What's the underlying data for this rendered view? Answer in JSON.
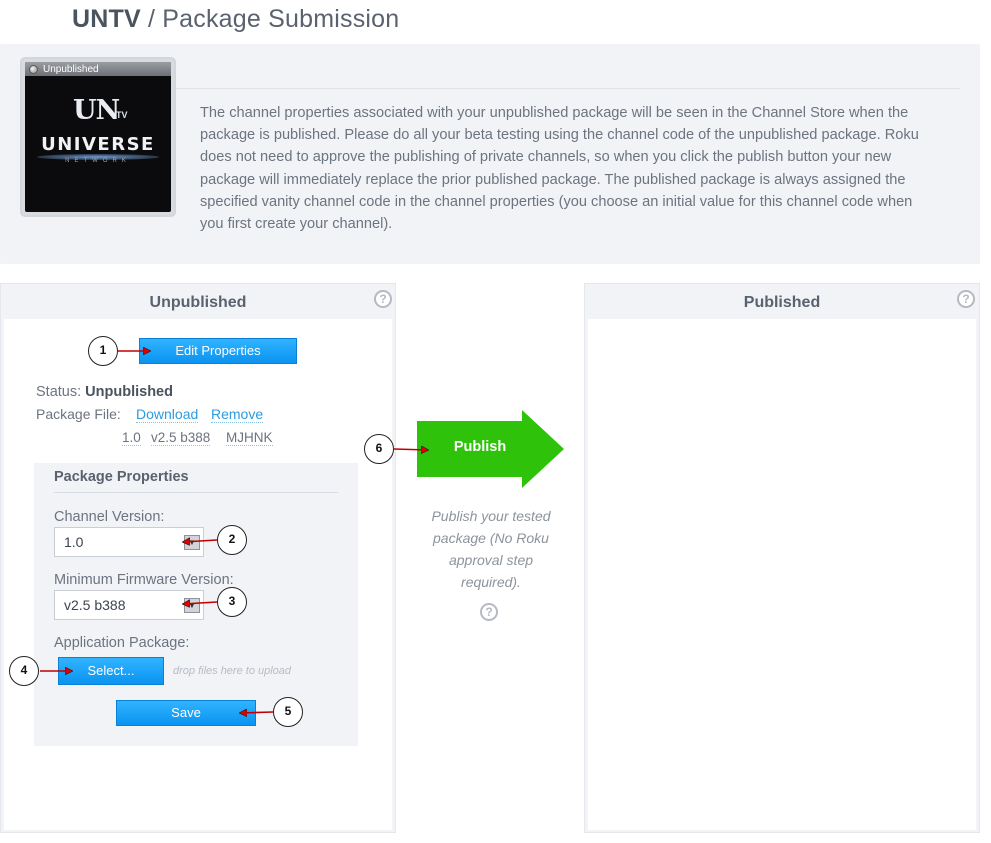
{
  "header": {
    "channel": "UNTV",
    "separator": " / ",
    "title": "Package Submission"
  },
  "info": {
    "thumbnail_badge": "Unpublished",
    "logo_top": "UN",
    "logo_tv": "TV",
    "logo_main": "UNIVERSE",
    "logo_sub": "NETWORK",
    "text": "The channel properties associated with your unpublished package will be seen in the Channel Store when the package is published. Please do all your beta testing using the channel code of the unpublished package. Roku does not need to approve the publishing of private channels, so when you click the publish button your new package will immediately replace the prior published package. The published package is always assigned the specified vanity channel code in the channel properties (you choose an initial value for this channel code when you first create your channel)."
  },
  "unpublished": {
    "heading": "Unpublished",
    "help": "?",
    "edit_button": "Edit Properties",
    "status_label": "Status: ",
    "status_value": "Unpublished",
    "package_file_label": "Package File: ",
    "download_link": "Download",
    "remove_link": "Remove",
    "version": "1.0",
    "build": "v2.5 b388",
    "code": "MJHNK"
  },
  "package_properties": {
    "title": "Package Properties",
    "channel_version_label": "Channel Version:",
    "channel_version_value": "1.0",
    "min_firmware_label": "Minimum Firmware Version:",
    "min_firmware_value": "v2.5 b388",
    "app_package_label": "Application Package:",
    "select_button": "Select...",
    "drop_hint": "drop files here to upload",
    "save_button": "Save"
  },
  "publish": {
    "button": "Publish",
    "note": "Publish your tested package (No Roku approval step required).",
    "help": "?",
    "arrow_color": "#2ec20a"
  },
  "published": {
    "heading": "Published",
    "help": "?"
  },
  "callouts": [
    "1",
    "2",
    "3",
    "4",
    "5",
    "6"
  ],
  "colors": {
    "button_blue": "#1aa3f5",
    "panel_gray": "#f1f3f6",
    "link_blue": "#2d9bdc",
    "callout_arrow": "#e00000"
  }
}
